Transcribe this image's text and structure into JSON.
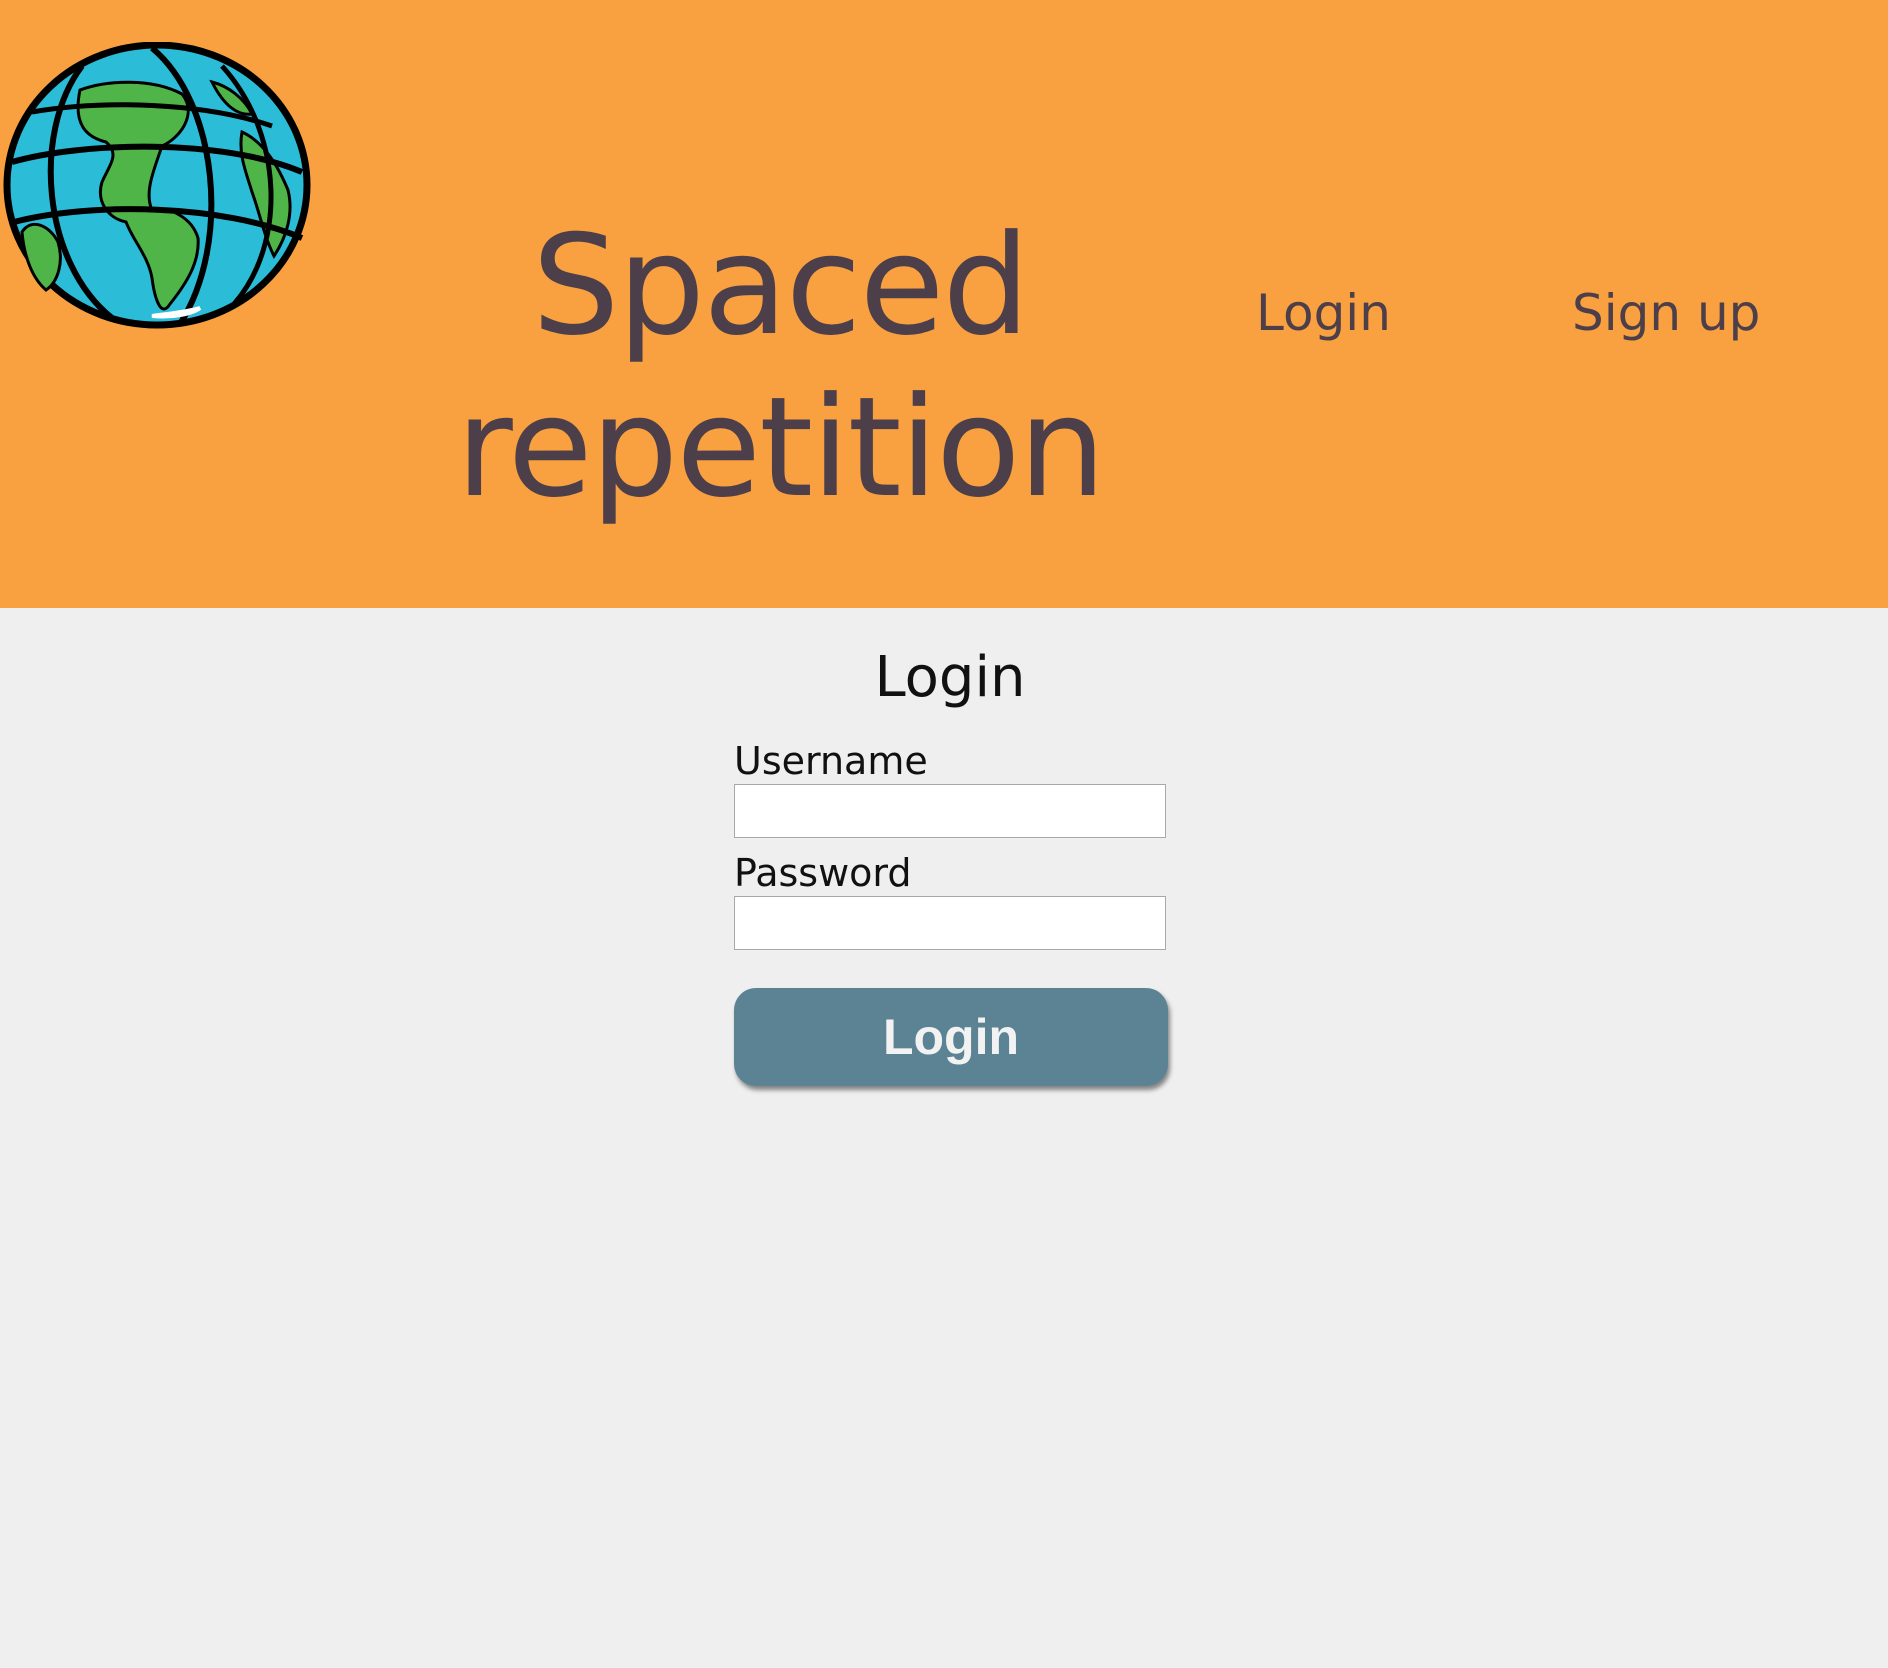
{
  "header": {
    "title_line1": "Spaced",
    "title_line2": "repetition",
    "logo_icon": "globe-icon",
    "nav": {
      "login_label": "Login",
      "signup_label": "Sign up"
    }
  },
  "login_form": {
    "title": "Login",
    "username_label": "Username",
    "username_value": "",
    "password_label": "Password",
    "password_value": "",
    "submit_label": "Login"
  },
  "colors": {
    "header_bg": "#f9a040",
    "header_text": "#4c3f4a",
    "page_bg": "#efefef",
    "button_bg": "#5b8393",
    "button_text": "#f2f2f2",
    "globe_ocean": "#2bbcd8",
    "globe_land": "#4fb548"
  }
}
